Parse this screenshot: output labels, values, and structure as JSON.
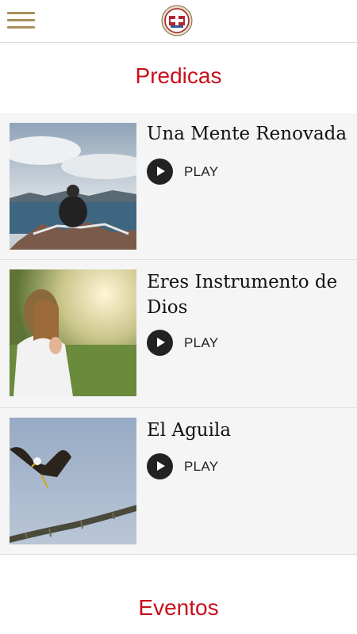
{
  "header": {
    "menu_icon": "hamburger-menu-icon",
    "logo": "church-seal-logo"
  },
  "sections": [
    {
      "title": "Predicas"
    },
    {
      "title": "Eventos"
    }
  ],
  "sermons": [
    {
      "title": "Una Mente Renovada",
      "play_label": "PLAY",
      "image": "person-sitting-on-rock-by-lake"
    },
    {
      "title": "Eres Instrumento de Dios",
      "play_label": "PLAY",
      "image": "woman-praying-in-field"
    },
    {
      "title": "El Aguila",
      "play_label": "PLAY",
      "image": "eagle-landing-on-branch"
    }
  ],
  "colors": {
    "accent": "#c8101c",
    "menu": "#a88f5c",
    "card_bg": "#f5f5f5"
  }
}
